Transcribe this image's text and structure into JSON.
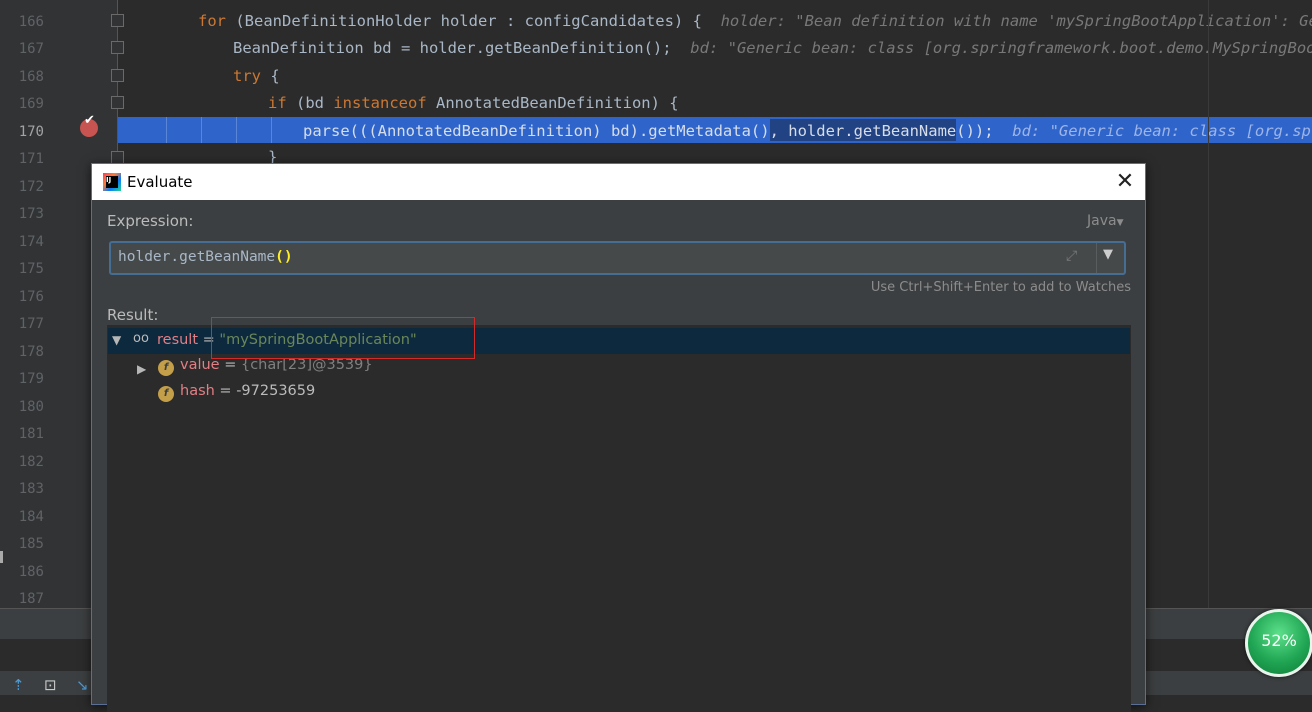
{
  "editor": {
    "line_numbers": [
      "166",
      "167",
      "168",
      "169",
      "170",
      "171",
      "172",
      "173",
      "174",
      "175",
      "176",
      "177",
      "178",
      "179",
      "180",
      "181",
      "182",
      "183",
      "184",
      "185",
      "186",
      "187"
    ],
    "current_line": "170",
    "code": {
      "l166_kw": "for",
      "l166_code": " (BeanDefinitionHolder holder : configCandidates) {",
      "l166_hint": "holder: \"Bean definition with name 'mySpringBootApplication': Generi",
      "l167_code": "BeanDefinition bd = holder.getBeanDefinition();",
      "l167_hint": "bd: \"Generic bean: class [org.springframework.boot.demo.MySpringBootApp",
      "l168_kw": "try",
      "l168_code": " {",
      "l169_kw": "if",
      "l169_code_a": " (bd ",
      "l169_kw2": "instanceof",
      "l169_code_b": " AnnotatedBeanDefinition) {",
      "l170_code_a": "parse(((AnnotatedBeanDefinition) bd).getMetadata(), ",
      "l170_sel": "holder.getBeanName()",
      "l170_code_b": ");",
      "l170_hint": "bd: \"Generic bean: class [org.spring",
      "l171_code": "}"
    }
  },
  "dialog": {
    "title": "Evaluate",
    "expression_label": "Expression:",
    "language": "Java",
    "expression_value": "holder.getBeanName",
    "expression_parens": "()",
    "watch_hint": "Use Ctrl+Shift+Enter to add to Watches",
    "result_label": "Result:",
    "result": {
      "name": "result",
      "eq": " = ",
      "value": "\"mySpringBootApplication\"",
      "children": [
        {
          "name": "value",
          "eq": " = ",
          "value": "{char[23]@3539}",
          "icon": "f"
        },
        {
          "name": "hash",
          "eq": " = ",
          "value": "-97253659",
          "icon": "f"
        }
      ]
    }
  },
  "badge": {
    "text": "52%",
    "value": 52
  },
  "icons": [
    "app-icon",
    "close-icon",
    "expand-icon",
    "dropdown-icon",
    "watch-icon",
    "field-icon",
    "breakpoint-icon",
    "fold-icon",
    "toolbar-up-icon",
    "toolbar-add-icon",
    "toolbar-down-icon"
  ],
  "colors": {
    "highlight": "#2f65ca",
    "keyword": "#cc7832",
    "string": "#6a8759",
    "field_name": "#e27f85",
    "breakpoint": "#c75450",
    "badge": "#20a654",
    "annotation": "#d32a2a"
  }
}
